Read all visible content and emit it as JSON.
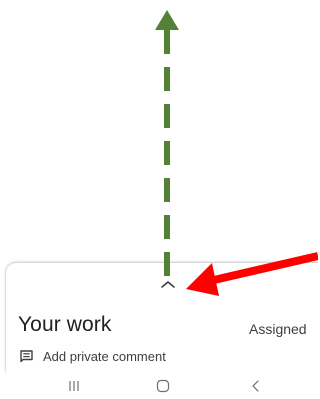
{
  "sheet": {
    "title": "Your work",
    "status": "Assigned",
    "comment_label": "Add private comment",
    "handle_icon": "chevron-up-icon",
    "comment_icon": "comment-icon"
  },
  "navbar": {
    "recents_icon": "recents-icon",
    "home_icon": "home-icon",
    "back_icon": "back-icon"
  },
  "annotations": {
    "dashed_arrow_color": "#538135",
    "pointer_arrow_color": "#ff0000"
  },
  "colors": {
    "text_primary": "#202124",
    "text_secondary": "#3c4043"
  }
}
